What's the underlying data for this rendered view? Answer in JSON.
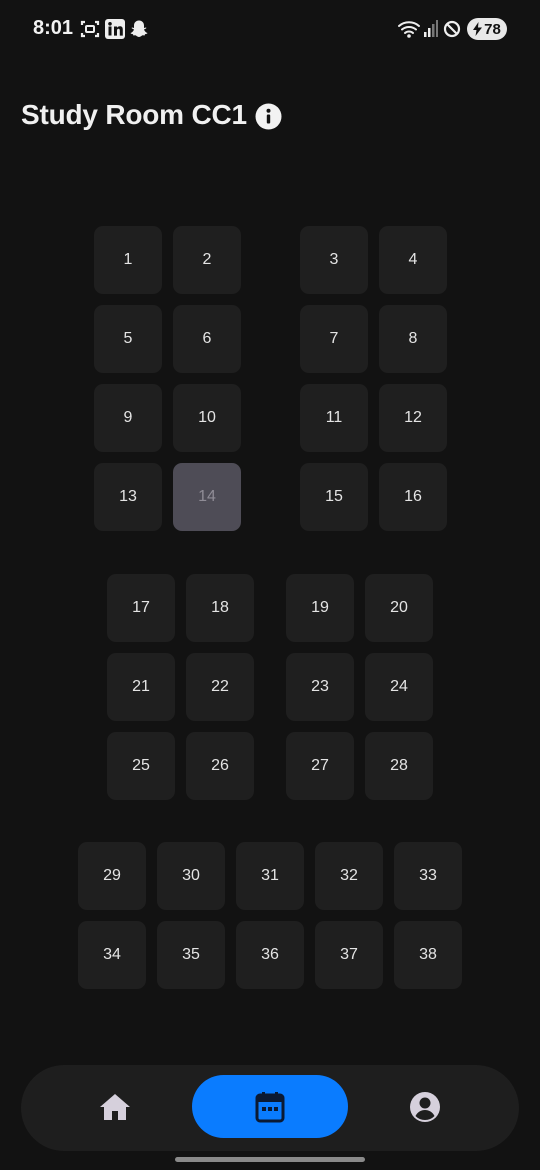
{
  "status_bar": {
    "time": "8:01",
    "battery": "78",
    "icons": [
      "screenshot-icon",
      "linkedin-icon",
      "snapchat-icon",
      "wifi-icon",
      "signal-icon",
      "do-not-disturb-icon",
      "battery-charging-icon"
    ]
  },
  "header": {
    "title": "Study Room CC1",
    "info_icon": "info-icon"
  },
  "seats": {
    "items": [
      "1",
      "2",
      "3",
      "4",
      "5",
      "6",
      "7",
      "8",
      "9",
      "10",
      "11",
      "12",
      "13",
      "14",
      "15",
      "16",
      "17",
      "18",
      "19",
      "20",
      "21",
      "22",
      "23",
      "24",
      "25",
      "26",
      "27",
      "28",
      "29",
      "30",
      "31",
      "32",
      "33",
      "34",
      "35",
      "36",
      "37",
      "38"
    ],
    "selected": "14"
  },
  "bottom_nav": {
    "items": [
      {
        "icon": "home-icon",
        "active": false
      },
      {
        "icon": "calendar-icon",
        "active": true
      },
      {
        "icon": "profile-icon",
        "active": false
      }
    ],
    "accent": "#0a7cff"
  },
  "colors": {
    "background": "#121212",
    "seat": "#1f1f1f",
    "seat_selected": "#4e4c56",
    "accent": "#0a7cff"
  }
}
